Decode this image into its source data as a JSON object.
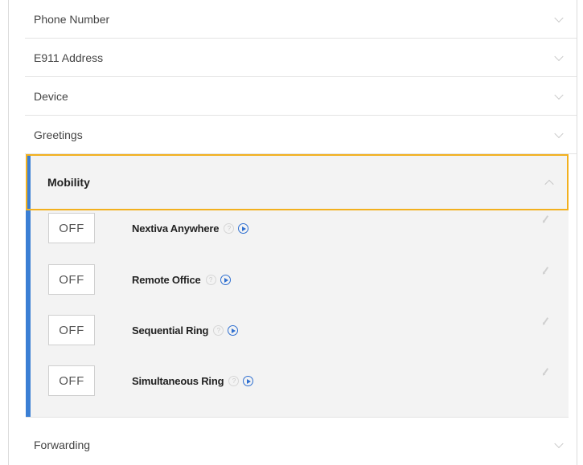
{
  "sections": {
    "phone_number": "Phone Number",
    "e911_address": "E911 Address",
    "device": "Device",
    "greetings": "Greetings",
    "forwarding": "Forwarding"
  },
  "mobility": {
    "title": "Mobility",
    "expanded": true,
    "features": [
      {
        "toggle": "OFF",
        "name": "Nextiva Anywhere",
        "help": "?"
      },
      {
        "toggle": "OFF",
        "name": "Remote Office",
        "help": "?"
      },
      {
        "toggle": "OFF",
        "name": "Sequential Ring",
        "help": "?"
      },
      {
        "toggle": "OFF",
        "name": "Simultaneous Ring",
        "help": "?"
      }
    ]
  },
  "colors": {
    "highlight_border": "#f2b01e",
    "active_bar": "#3b7fd4",
    "play_icon": "#2f6fd0"
  }
}
